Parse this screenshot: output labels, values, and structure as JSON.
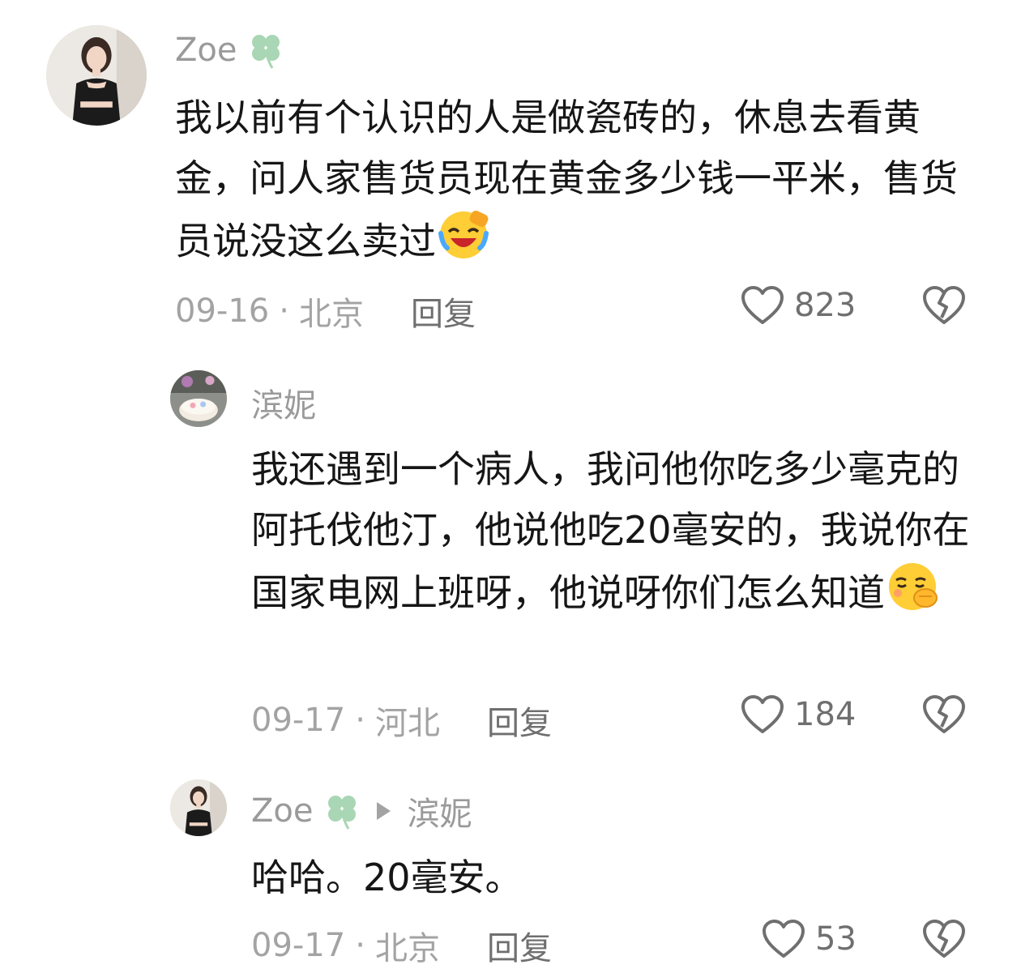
{
  "comments": [
    {
      "user": "Zoe",
      "badge_icon": "clover-icon",
      "text": "我以前有个认识的人是做瓷砖的，休息去看黄金，问人家售货员现在黄金多少钱一平米，售货员说没这么卖过",
      "emoji": "laughing-crying-emoji",
      "date": "09-16",
      "separator": "·",
      "location": "北京",
      "reply_label": "回复",
      "likes": "823"
    },
    {
      "user": "滨妮",
      "text": "我还遇到一个病人，我问他你吃多少毫克的阿托伐他汀，他说他吃20毫安的，我说你在国家电网上班呀，他说呀你们怎么知道",
      "emoji": "shushing-emoji",
      "date": "09-17",
      "separator": "·",
      "location": "河北",
      "reply_label": "回复",
      "likes": "184"
    },
    {
      "user": "Zoe",
      "badge_icon": "clover-icon",
      "reply_to": "滨妮",
      "text": "哈哈。20毫安。",
      "date": "09-17",
      "separator": "·",
      "location": "北京",
      "reply_label": "回复",
      "likes": "53"
    }
  ],
  "colors": {
    "name": "#9a9a9a",
    "meta": "#a3a3a3",
    "text": "#161616",
    "clover": "#a9d6b4",
    "icon": "#6f6f6f"
  }
}
